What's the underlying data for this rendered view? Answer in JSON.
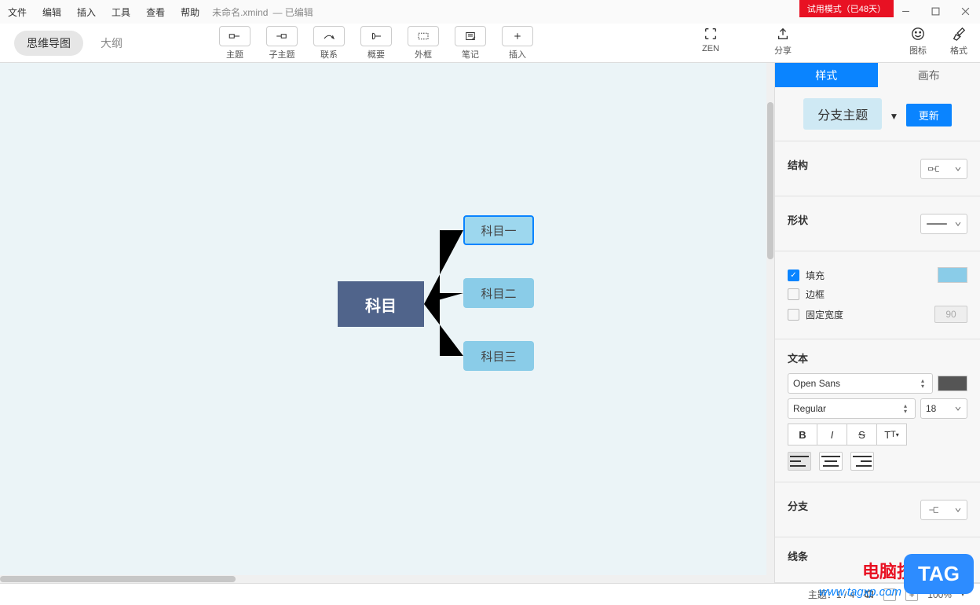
{
  "menu": [
    "文件",
    "编辑",
    "插入",
    "工具",
    "查看",
    "帮助"
  ],
  "file_title": "未命名.xmind",
  "edit_state": "— 已编辑",
  "trial": "试用模式（已48天）",
  "mode_pill": "思维导图",
  "mode_outline": "大纲",
  "toolbar": [
    {
      "label": "主题",
      "icon": "topic"
    },
    {
      "label": "子主题",
      "icon": "subtopic"
    },
    {
      "label": "联系",
      "icon": "relation"
    },
    {
      "label": "概要",
      "icon": "summary"
    },
    {
      "label": "外框",
      "icon": "boundary"
    },
    {
      "label": "笔记",
      "icon": "note"
    },
    {
      "label": "插入",
      "icon": "insert"
    }
  ],
  "right_tools": {
    "zen": "ZEN",
    "share": "分享",
    "icons": "图标",
    "format": "格式"
  },
  "central": "科目",
  "subs": [
    "科目一",
    "科目二",
    "科目三"
  ],
  "tabs": {
    "style": "样式",
    "canvas": "画布"
  },
  "branch_type": "分支主题",
  "update": "更新",
  "sec_structure": "结构",
  "sec_shape": "形状",
  "fill": "填充",
  "border": "边框",
  "fixed_w": "固定宽度",
  "fixed_w_val": "90",
  "sec_text": "文本",
  "font": "Open Sans",
  "weight": "Regular",
  "size": "18",
  "sec_branch": "分支",
  "sec_line": "线条",
  "status_topic": "主题：1 / 4",
  "zoom": "100%",
  "wm1": "电脑技术网",
  "wm2": "www.tagxp.com",
  "tag": "TAG"
}
